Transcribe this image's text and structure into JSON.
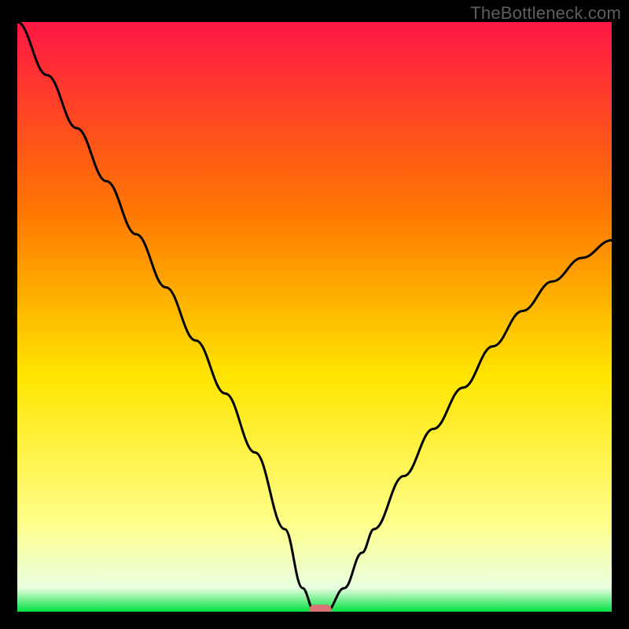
{
  "watermark": "TheBottleneck.com",
  "chart_data": {
    "type": "line",
    "title": "",
    "xlabel": "",
    "ylabel": "",
    "xlim": [
      0,
      100
    ],
    "ylim": [
      0,
      100
    ],
    "grid": false,
    "x": [
      0,
      5,
      10,
      15,
      20,
      25,
      30,
      35,
      40,
      45,
      48,
      50,
      52,
      55,
      58,
      60,
      65,
      70,
      75,
      80,
      85,
      90,
      95,
      100
    ],
    "values": [
      100,
      91,
      82,
      73,
      64,
      55,
      46,
      37,
      27,
      14,
      4,
      0,
      0,
      4,
      10,
      14,
      23,
      31,
      38,
      45,
      51,
      56,
      60,
      63
    ],
    "marker": {
      "x": 51,
      "y": 0
    },
    "gradient_colors": {
      "top": "#ff1744",
      "mid_upper": "#ff7a00",
      "mid": "#ffe500",
      "lower": "#ffff8a",
      "bottom_edge": "#e8ffe0",
      "bottom": "#00e040"
    },
    "line_color": "#000000",
    "marker_color": "#d97272"
  }
}
